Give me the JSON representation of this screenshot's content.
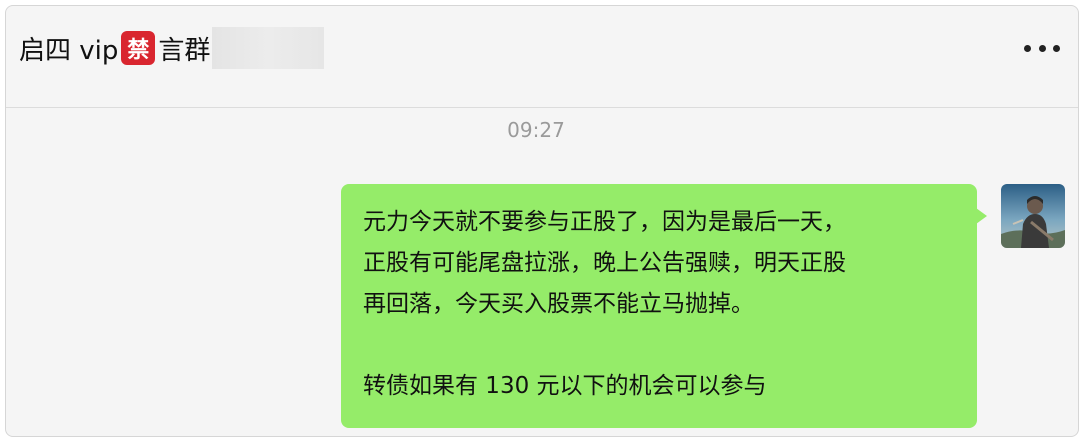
{
  "header": {
    "title_part1": "启四 vip",
    "ban_emoji": "禁",
    "title_part2": "言群",
    "more_icon": "more-dots-icon"
  },
  "chat": {
    "timestamp": "09:27",
    "message_lines": [
      "元力今天就不要参与正股了，因为是最后一天，",
      "正股有可能尾盘拉涨，晚上公告强赎，明天正股",
      "再回落，今天买入股票不能立马抛掉。",
      "",
      "转债如果有 130 元以下的机会可以参与"
    ],
    "bubble_color": "#95ec69",
    "avatar_icon": "user-avatar-icon"
  }
}
